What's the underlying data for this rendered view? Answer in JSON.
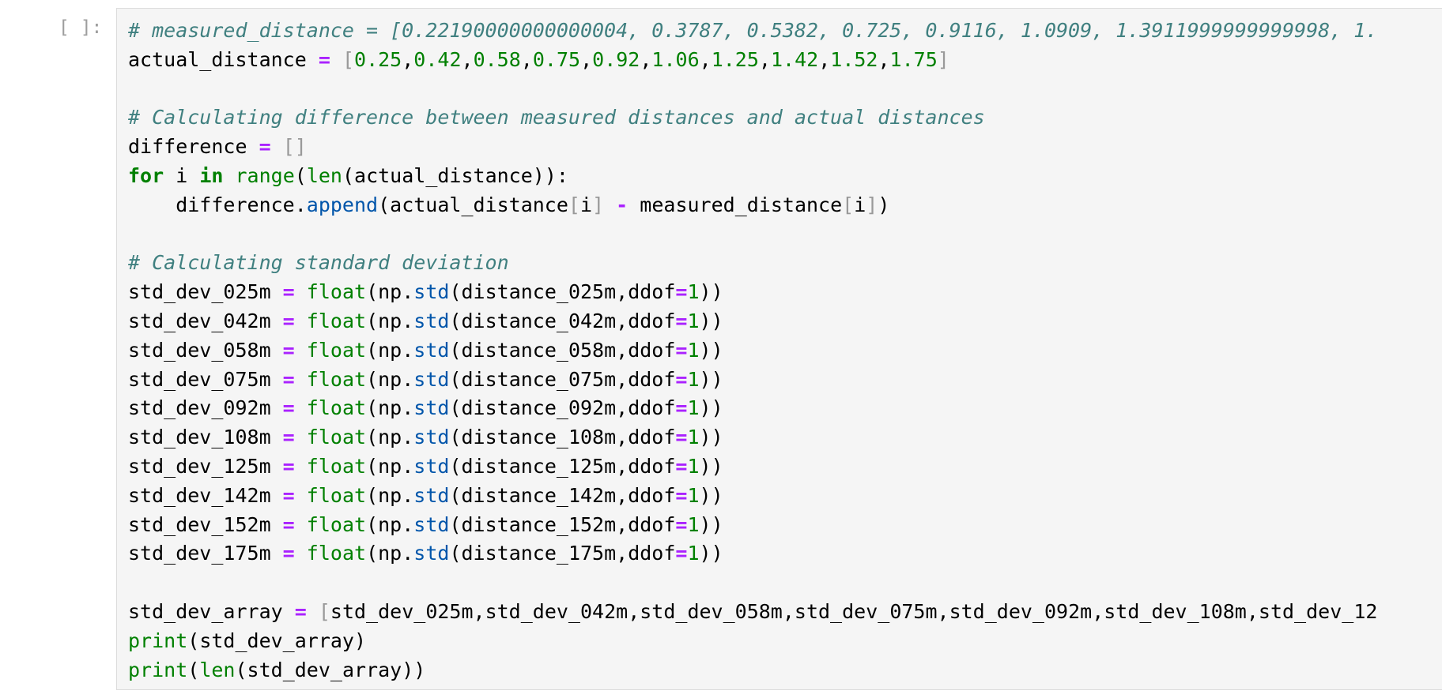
{
  "cell": {
    "prompt": "[ ]:",
    "lines": [
      [
        {
          "t": "# measured_distance = [0.22190000000000004, 0.3787, 0.5382, 0.725, 0.9116, 1.0909, 1.3911999999999998, 1.",
          "c": "c"
        }
      ],
      [
        {
          "t": "actual_distance ",
          "c": "p"
        },
        {
          "t": "=",
          "c": "o"
        },
        {
          "t": " ",
          "c": "p"
        },
        {
          "t": "[",
          "c": "br"
        },
        {
          "t": "0.25",
          "c": "n"
        },
        {
          "t": ",",
          "c": "p"
        },
        {
          "t": "0.42",
          "c": "n"
        },
        {
          "t": ",",
          "c": "p"
        },
        {
          "t": "0.58",
          "c": "n"
        },
        {
          "t": ",",
          "c": "p"
        },
        {
          "t": "0.75",
          "c": "n"
        },
        {
          "t": ",",
          "c": "p"
        },
        {
          "t": "0.92",
          "c": "n"
        },
        {
          "t": ",",
          "c": "p"
        },
        {
          "t": "1.06",
          "c": "n"
        },
        {
          "t": ",",
          "c": "p"
        },
        {
          "t": "1.25",
          "c": "n"
        },
        {
          "t": ",",
          "c": "p"
        },
        {
          "t": "1.42",
          "c": "n"
        },
        {
          "t": ",",
          "c": "p"
        },
        {
          "t": "1.52",
          "c": "n"
        },
        {
          "t": ",",
          "c": "p"
        },
        {
          "t": "1.75",
          "c": "n"
        },
        {
          "t": "]",
          "c": "br"
        }
      ],
      [],
      [
        {
          "t": "# Calculating difference between measured distances and actual distances",
          "c": "c"
        }
      ],
      [
        {
          "t": "difference ",
          "c": "p"
        },
        {
          "t": "=",
          "c": "o"
        },
        {
          "t": " ",
          "c": "p"
        },
        {
          "t": "[]",
          "c": "br"
        }
      ],
      [
        {
          "t": "for",
          "c": "k"
        },
        {
          "t": " i ",
          "c": "p"
        },
        {
          "t": "in",
          "c": "k"
        },
        {
          "t": " ",
          "c": "p"
        },
        {
          "t": "range",
          "c": "b"
        },
        {
          "t": "(",
          "c": "p"
        },
        {
          "t": "len",
          "c": "b"
        },
        {
          "t": "(actual_distance)):",
          "c": "p"
        }
      ],
      [
        {
          "t": "    difference.",
          "c": "p"
        },
        {
          "t": "append",
          "c": "f"
        },
        {
          "t": "(actual_distance",
          "c": "p"
        },
        {
          "t": "[",
          "c": "br"
        },
        {
          "t": "i",
          "c": "p"
        },
        {
          "t": "]",
          "c": "br"
        },
        {
          "t": " ",
          "c": "p"
        },
        {
          "t": "-",
          "c": "o"
        },
        {
          "t": " measured_distance",
          "c": "p"
        },
        {
          "t": "[",
          "c": "br"
        },
        {
          "t": "i",
          "c": "p"
        },
        {
          "t": "]",
          "c": "br"
        },
        {
          "t": ")",
          "c": "p"
        }
      ],
      [],
      [
        {
          "t": "# Calculating standard deviation",
          "c": "c"
        }
      ],
      [
        {
          "t": "std_dev_025m ",
          "c": "p"
        },
        {
          "t": "=",
          "c": "o"
        },
        {
          "t": " ",
          "c": "p"
        },
        {
          "t": "float",
          "c": "b"
        },
        {
          "t": "(np.",
          "c": "p"
        },
        {
          "t": "std",
          "c": "f"
        },
        {
          "t": "(distance_025m,ddof",
          "c": "p"
        },
        {
          "t": "=",
          "c": "o"
        },
        {
          "t": "1",
          "c": "n"
        },
        {
          "t": "))",
          "c": "p"
        }
      ],
      [
        {
          "t": "std_dev_042m ",
          "c": "p"
        },
        {
          "t": "=",
          "c": "o"
        },
        {
          "t": " ",
          "c": "p"
        },
        {
          "t": "float",
          "c": "b"
        },
        {
          "t": "(np.",
          "c": "p"
        },
        {
          "t": "std",
          "c": "f"
        },
        {
          "t": "(distance_042m,ddof",
          "c": "p"
        },
        {
          "t": "=",
          "c": "o"
        },
        {
          "t": "1",
          "c": "n"
        },
        {
          "t": "))",
          "c": "p"
        }
      ],
      [
        {
          "t": "std_dev_058m ",
          "c": "p"
        },
        {
          "t": "=",
          "c": "o"
        },
        {
          "t": " ",
          "c": "p"
        },
        {
          "t": "float",
          "c": "b"
        },
        {
          "t": "(np.",
          "c": "p"
        },
        {
          "t": "std",
          "c": "f"
        },
        {
          "t": "(distance_058m,ddof",
          "c": "p"
        },
        {
          "t": "=",
          "c": "o"
        },
        {
          "t": "1",
          "c": "n"
        },
        {
          "t": "))",
          "c": "p"
        }
      ],
      [
        {
          "t": "std_dev_075m ",
          "c": "p"
        },
        {
          "t": "=",
          "c": "o"
        },
        {
          "t": " ",
          "c": "p"
        },
        {
          "t": "float",
          "c": "b"
        },
        {
          "t": "(np.",
          "c": "p"
        },
        {
          "t": "std",
          "c": "f"
        },
        {
          "t": "(distance_075m,ddof",
          "c": "p"
        },
        {
          "t": "=",
          "c": "o"
        },
        {
          "t": "1",
          "c": "n"
        },
        {
          "t": "))",
          "c": "p"
        }
      ],
      [
        {
          "t": "std_dev_092m ",
          "c": "p"
        },
        {
          "t": "=",
          "c": "o"
        },
        {
          "t": " ",
          "c": "p"
        },
        {
          "t": "float",
          "c": "b"
        },
        {
          "t": "(np.",
          "c": "p"
        },
        {
          "t": "std",
          "c": "f"
        },
        {
          "t": "(distance_092m,ddof",
          "c": "p"
        },
        {
          "t": "=",
          "c": "o"
        },
        {
          "t": "1",
          "c": "n"
        },
        {
          "t": "))",
          "c": "p"
        }
      ],
      [
        {
          "t": "std_dev_108m ",
          "c": "p"
        },
        {
          "t": "=",
          "c": "o"
        },
        {
          "t": " ",
          "c": "p"
        },
        {
          "t": "float",
          "c": "b"
        },
        {
          "t": "(np.",
          "c": "p"
        },
        {
          "t": "std",
          "c": "f"
        },
        {
          "t": "(distance_108m,ddof",
          "c": "p"
        },
        {
          "t": "=",
          "c": "o"
        },
        {
          "t": "1",
          "c": "n"
        },
        {
          "t": "))",
          "c": "p"
        }
      ],
      [
        {
          "t": "std_dev_125m ",
          "c": "p"
        },
        {
          "t": "=",
          "c": "o"
        },
        {
          "t": " ",
          "c": "p"
        },
        {
          "t": "float",
          "c": "b"
        },
        {
          "t": "(np.",
          "c": "p"
        },
        {
          "t": "std",
          "c": "f"
        },
        {
          "t": "(distance_125m,ddof",
          "c": "p"
        },
        {
          "t": "=",
          "c": "o"
        },
        {
          "t": "1",
          "c": "n"
        },
        {
          "t": "))",
          "c": "p"
        }
      ],
      [
        {
          "t": "std_dev_142m ",
          "c": "p"
        },
        {
          "t": "=",
          "c": "o"
        },
        {
          "t": " ",
          "c": "p"
        },
        {
          "t": "float",
          "c": "b"
        },
        {
          "t": "(np.",
          "c": "p"
        },
        {
          "t": "std",
          "c": "f"
        },
        {
          "t": "(distance_142m,ddof",
          "c": "p"
        },
        {
          "t": "=",
          "c": "o"
        },
        {
          "t": "1",
          "c": "n"
        },
        {
          "t": "))",
          "c": "p"
        }
      ],
      [
        {
          "t": "std_dev_152m ",
          "c": "p"
        },
        {
          "t": "=",
          "c": "o"
        },
        {
          "t": " ",
          "c": "p"
        },
        {
          "t": "float",
          "c": "b"
        },
        {
          "t": "(np.",
          "c": "p"
        },
        {
          "t": "std",
          "c": "f"
        },
        {
          "t": "(distance_152m,ddof",
          "c": "p"
        },
        {
          "t": "=",
          "c": "o"
        },
        {
          "t": "1",
          "c": "n"
        },
        {
          "t": "))",
          "c": "p"
        }
      ],
      [
        {
          "t": "std_dev_175m ",
          "c": "p"
        },
        {
          "t": "=",
          "c": "o"
        },
        {
          "t": " ",
          "c": "p"
        },
        {
          "t": "float",
          "c": "b"
        },
        {
          "t": "(np.",
          "c": "p"
        },
        {
          "t": "std",
          "c": "f"
        },
        {
          "t": "(distance_175m,ddof",
          "c": "p"
        },
        {
          "t": "=",
          "c": "o"
        },
        {
          "t": "1",
          "c": "n"
        },
        {
          "t": "))",
          "c": "p"
        }
      ],
      [],
      [
        {
          "t": "std_dev_array ",
          "c": "p"
        },
        {
          "t": "=",
          "c": "o"
        },
        {
          "t": " ",
          "c": "p"
        },
        {
          "t": "[",
          "c": "br"
        },
        {
          "t": "std_dev_025m,std_dev_042m,std_dev_058m,std_dev_075m,std_dev_092m,std_dev_108m,std_dev_12",
          "c": "p"
        }
      ],
      [
        {
          "t": "print",
          "c": "b"
        },
        {
          "t": "(std_dev_array)",
          "c": "p"
        }
      ],
      [
        {
          "t": "print",
          "c": "b"
        },
        {
          "t": "(",
          "c": "p"
        },
        {
          "t": "len",
          "c": "b"
        },
        {
          "t": "(std_dev_array))",
          "c": "p"
        }
      ]
    ]
  }
}
